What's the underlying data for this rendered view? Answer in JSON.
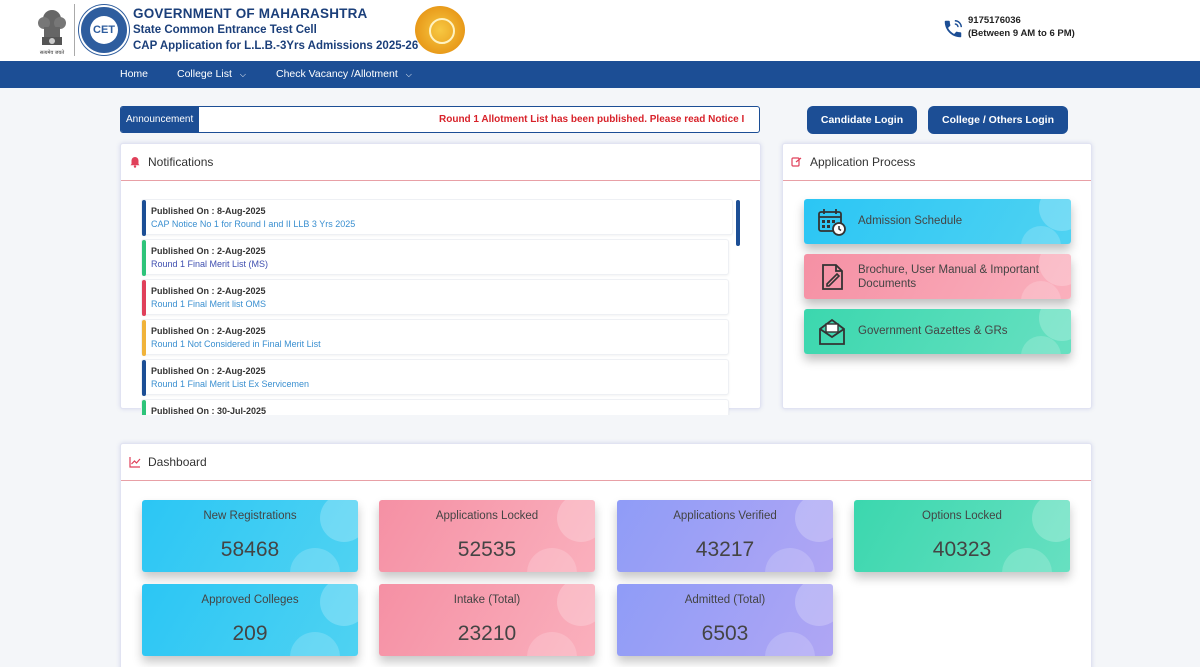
{
  "header": {
    "emblem_caption": "सत्यमेव जयते",
    "cet_logo_text": "CET",
    "title_line1": "GOVERNMENT OF MAHARASHTRA",
    "title_line2": "State Common Entrance Test Cell",
    "title_line3": "CAP Application for L.L.B.-3Yrs Admissions 2025-26",
    "phone": "9175176036",
    "phone_hours": "(Between 9 AM to 6 PM)"
  },
  "nav": {
    "items": [
      {
        "label": "Home",
        "has_dropdown": false
      },
      {
        "label": "College List",
        "has_dropdown": true
      },
      {
        "label": "Check Vacancy /Allotment",
        "has_dropdown": true
      }
    ],
    "caret": "⌵"
  },
  "announcement": {
    "tag": "Announcement",
    "text": "Round 1 Allotment List has been published. Please read Notice I"
  },
  "login": {
    "candidate": "Candidate Login",
    "college": "College / Others Login"
  },
  "notifications": {
    "title": "Notifications",
    "items": [
      {
        "date": "Published On : 8-Aug-2025",
        "text": "CAP Notice No 1 for Round I and II LLB 3 Yrs 2025",
        "color": "#1c4e95"
      },
      {
        "date": "Published On : 2-Aug-2025",
        "text": "Round 1 Final Merit List (MS)",
        "color": "#2ec47a"
      },
      {
        "date": "Published On : 2-Aug-2025",
        "text": "Round 1 Final Merit list OMS",
        "color": "#e0405a"
      },
      {
        "date": "Published On : 2-Aug-2025",
        "text": "Round 1 Not Considered in Final Merit List",
        "color": "#f0b33a"
      },
      {
        "date": "Published On : 2-Aug-2025",
        "text": "Round 1 Final Merit List Ex Servicemen",
        "color": "#1c4e95"
      },
      {
        "date": "Published On : 30-Jul-2025",
        "text": "",
        "color": "#2ec47a"
      }
    ]
  },
  "process": {
    "title": "Application Process",
    "items": [
      {
        "label": "Admission Schedule",
        "icon": "calendar-icon"
      },
      {
        "label": "Brochure, User Manual & Important Documents",
        "icon": "document-icon"
      },
      {
        "label": "Government Gazettes & GRs",
        "icon": "envelope-icon"
      }
    ]
  },
  "dashboard": {
    "title": "Dashboard",
    "stats": [
      {
        "label": "New Registrations",
        "value": "58468"
      },
      {
        "label": "Applications Locked",
        "value": "52535"
      },
      {
        "label": "Applications Verified",
        "value": "43217"
      },
      {
        "label": "Options Locked",
        "value": "40323"
      },
      {
        "label": "Approved Colleges",
        "value": "209"
      },
      {
        "label": "Intake (Total)",
        "value": "23210"
      },
      {
        "label": "Admitted (Total)",
        "value": "6503"
      }
    ]
  },
  "colors": {
    "brand": "#1c4e95",
    "alert": "#d8222a",
    "link": "#3a8fd0"
  }
}
